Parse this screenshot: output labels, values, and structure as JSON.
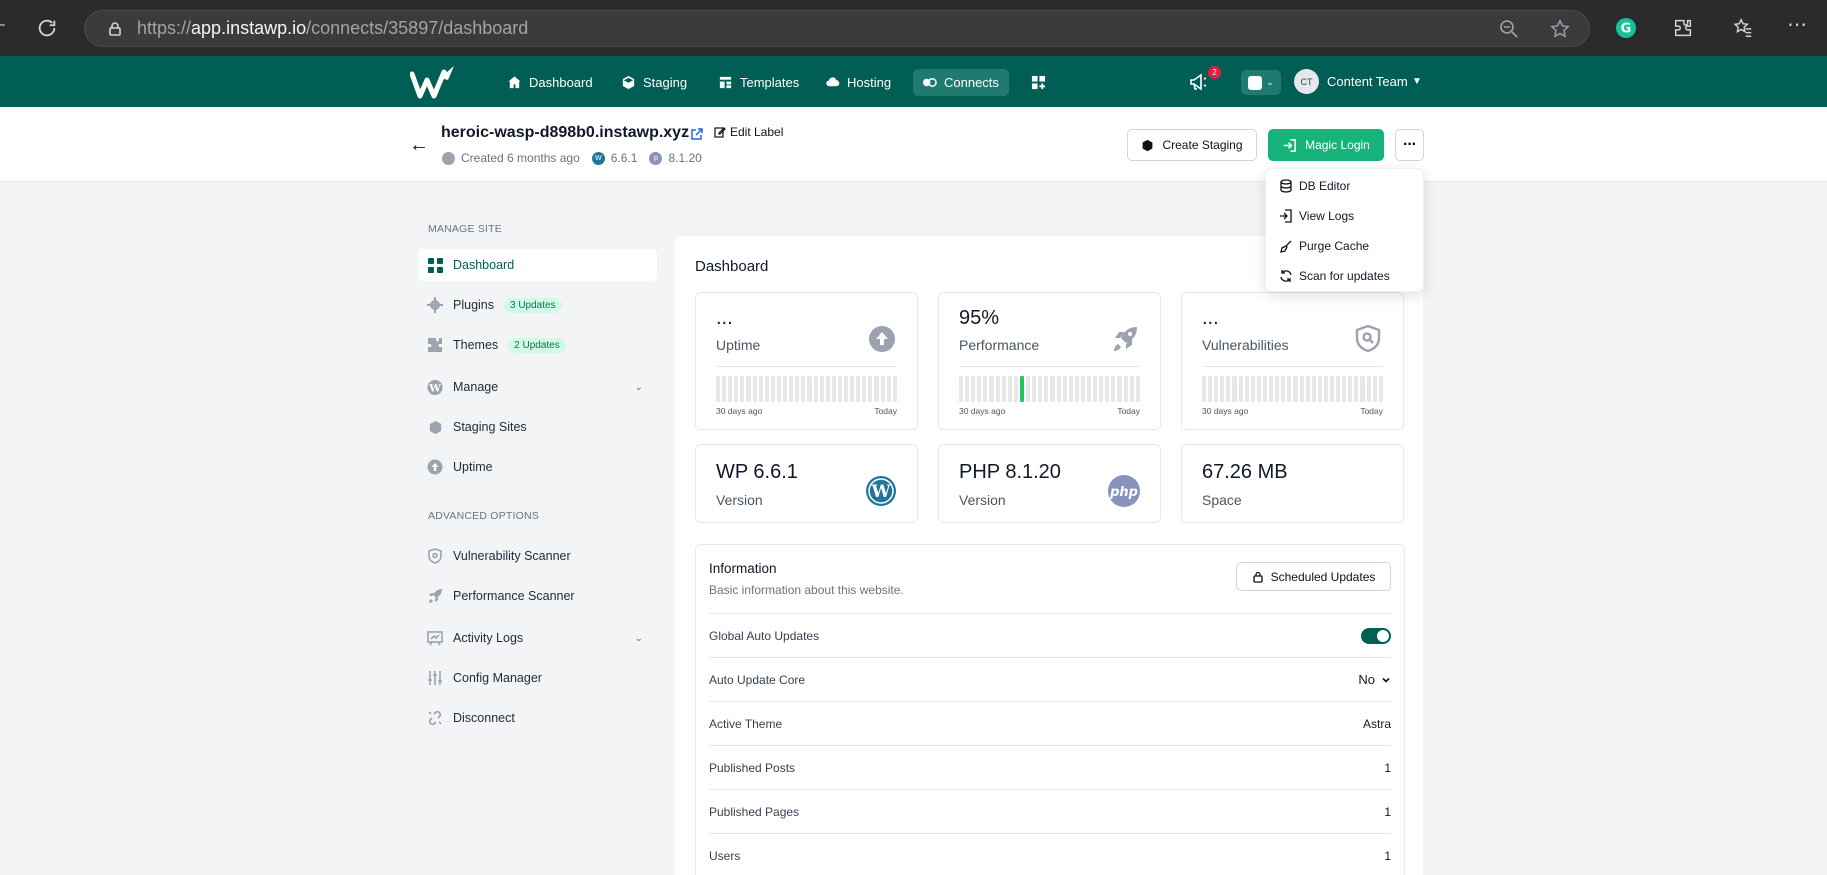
{
  "browser": {
    "url_host": "app.instawp.io",
    "url_path": "/connects/35897/dashboard",
    "url_scheme": "https://"
  },
  "nav": {
    "items": [
      {
        "label": "Dashboard",
        "icon": "home-icon"
      },
      {
        "label": "Staging",
        "icon": "cube-icon"
      },
      {
        "label": "Templates",
        "icon": "template-icon"
      },
      {
        "label": "Hosting",
        "icon": "cloud-icon"
      },
      {
        "label": "Connects",
        "icon": "connects-icon"
      }
    ],
    "notification_count": "2",
    "user_initials": "CT",
    "user_name": "Content Team"
  },
  "site": {
    "name": "heroic-wasp-d898b0.instawp.xyz",
    "edit_label": "Edit Label",
    "created": "Created 6 months ago",
    "wp_version": "6.6.1",
    "php_version": "8.1.20",
    "create_staging": "Create Staging",
    "magic_login": "Magic Login"
  },
  "dropdown": {
    "items": [
      "DB Editor",
      "View Logs",
      "Purge Cache",
      "Scan for updates"
    ]
  },
  "sidebar": {
    "manage_site_title": "MANAGE SITE",
    "advanced_title": "ADVANCED OPTIONS",
    "items": [
      {
        "label": "Dashboard"
      },
      {
        "label": "Plugins",
        "badge": "3 Updates"
      },
      {
        "label": "Themes",
        "badge": "2 Updates"
      },
      {
        "label": "Manage"
      },
      {
        "label": "Staging Sites"
      },
      {
        "label": "Uptime"
      }
    ],
    "advanced": [
      {
        "label": "Vulnerability Scanner"
      },
      {
        "label": "Performance Scanner"
      },
      {
        "label": "Activity Logs"
      },
      {
        "label": "Config Manager"
      },
      {
        "label": "Disconnect"
      }
    ]
  },
  "dashboard": {
    "title": "Dashboard",
    "stats": [
      {
        "value": "...",
        "label": "Uptime",
        "from": "30 days ago",
        "to": "Today"
      },
      {
        "value": "95%",
        "label": "Performance",
        "from": "30 days ago",
        "to": "Today"
      },
      {
        "value": "...",
        "label": "Vulnerabilities",
        "from": "30 days ago",
        "to": "Today"
      }
    ],
    "versions": [
      {
        "value": "WP 6.6.1",
        "label": "Version"
      },
      {
        "value": "PHP 8.1.20",
        "label": "Version"
      },
      {
        "value": "67.26 MB",
        "label": "Space"
      }
    ]
  },
  "information": {
    "title": "Information",
    "subtitle": "Basic information about this website.",
    "scheduled_updates": "Scheduled Updates",
    "rows": [
      {
        "key": "Global Auto Updates",
        "value": ""
      },
      {
        "key": "Auto Update Core",
        "value": "No"
      },
      {
        "key": "Active Theme",
        "value": "Astra"
      },
      {
        "key": "Published Posts",
        "value": "1"
      },
      {
        "key": "Published Pages",
        "value": "1"
      },
      {
        "key": "Users",
        "value": "1"
      }
    ],
    "global_auto_updates_on": true
  },
  "colors": {
    "brand": "#005e54",
    "accent": "#16b47a"
  }
}
